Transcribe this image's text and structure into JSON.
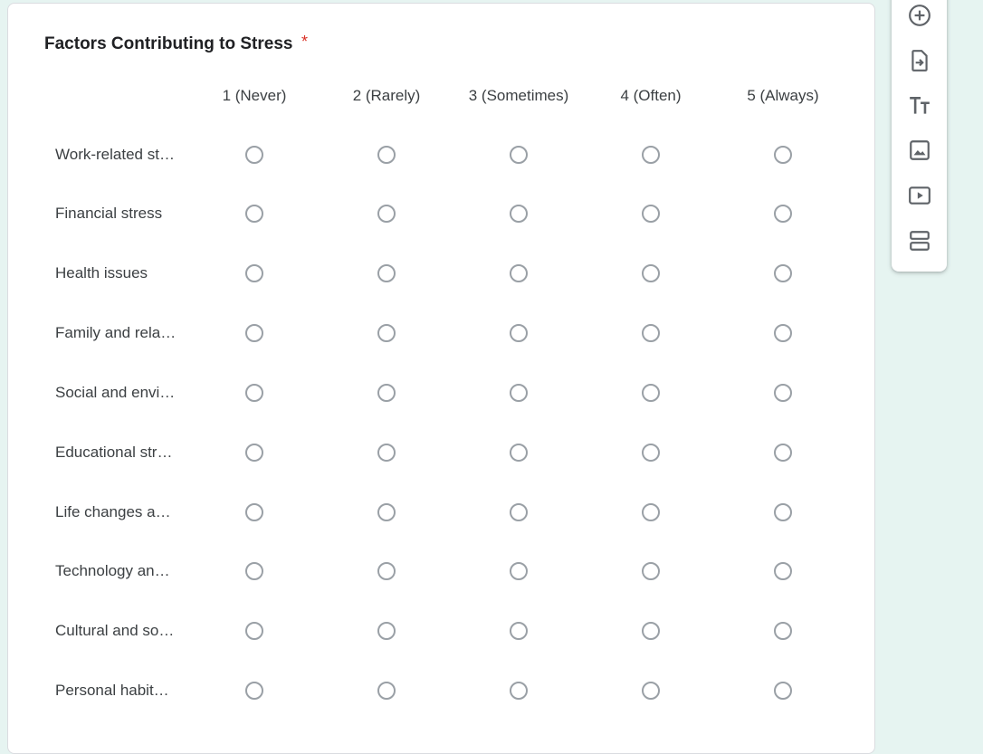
{
  "question": {
    "title": "Factors Contributing to Stress",
    "required_mark": "*"
  },
  "columns": [
    "1 (Never)",
    "2 (Rarely)",
    "3 (Sometimes)",
    "4 (Often)",
    "5 (Always)"
  ],
  "rows": [
    "Work-related st…",
    "Financial stress",
    "Health issues",
    "Family and rela…",
    "Social and envi…",
    "Educational str…",
    "Life changes a…",
    "Technology an…",
    "Cultural and so…",
    "Personal habit…"
  ],
  "toolbar": {
    "items": [
      {
        "icon": "add-circle-icon"
      },
      {
        "icon": "import-question-icon"
      },
      {
        "icon": "add-title-icon"
      },
      {
        "icon": "add-image-icon"
      },
      {
        "icon": "add-video-icon"
      },
      {
        "icon": "add-section-icon"
      }
    ]
  },
  "colors": {
    "background": "#e6f4f1",
    "required": "#d93025",
    "radio_border": "#9aa0a6",
    "text": "#3c4043"
  }
}
